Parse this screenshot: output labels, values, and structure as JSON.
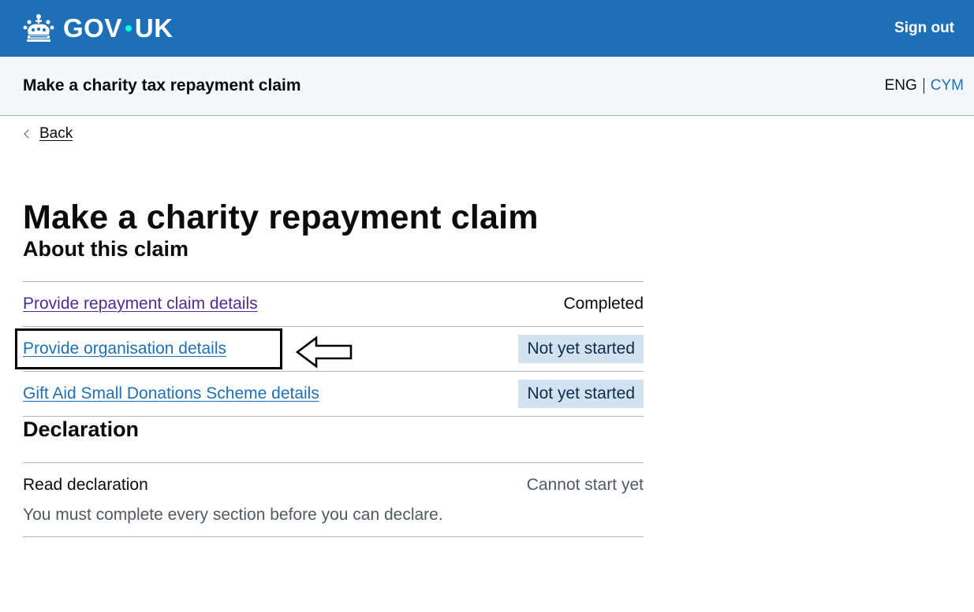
{
  "header": {
    "logo_text_left": "GOV",
    "logo_text_right": "UK",
    "sign_out_label": "Sign out",
    "background_color": "#1d70b8"
  },
  "service": {
    "name": "Make a charity tax repayment claim",
    "lang_current": "ENG",
    "lang_alternative": "CYM"
  },
  "nav": {
    "back_label": "Back"
  },
  "page": {
    "title": "Make a charity repayment claim"
  },
  "about": {
    "heading": "About this claim",
    "tasks": [
      {
        "label": "Provide repayment claim details",
        "status": "Completed",
        "visited": true
      },
      {
        "label": "Provide organisation details",
        "status": "Not yet started",
        "highlighted": true
      },
      {
        "label": "Gift Aid Small Donations Scheme details",
        "status": "Not yet started"
      }
    ]
  },
  "declaration": {
    "heading": "Declaration",
    "title": "Read declaration",
    "status": "Cannot start yet",
    "hint": "You must complete every section before you can declare."
  },
  "annotation": {
    "icon": "left-arrow-outline-icon",
    "box_color": "#000000"
  }
}
